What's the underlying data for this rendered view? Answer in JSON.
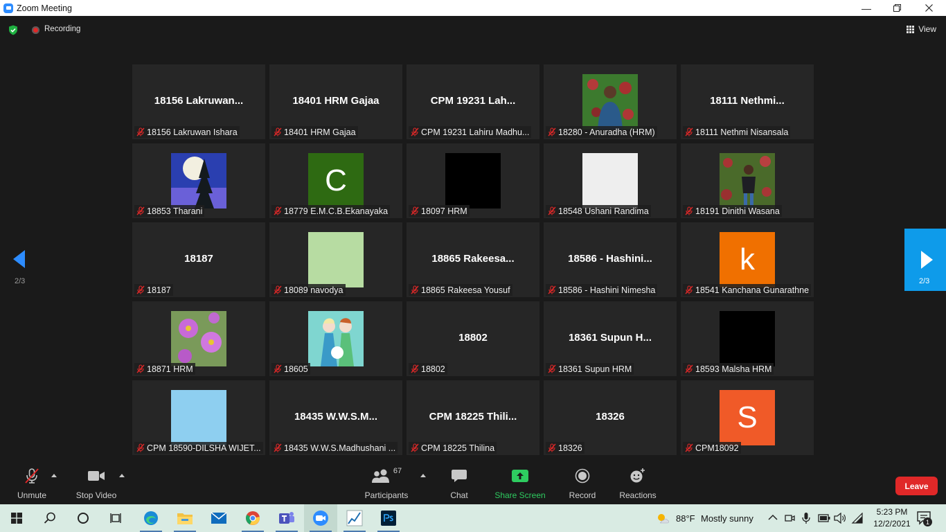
{
  "window": {
    "title": "Zoom Meeting"
  },
  "topbar": {
    "recording_label": "Recording",
    "view_label": "View"
  },
  "gallery": {
    "page_indicator": "2/3",
    "tiles": [
      {
        "big_name": "18156  Lakruwan...",
        "label": "18156 Lakruwan Ishara",
        "avatar": ""
      },
      {
        "big_name": "18401 HRM Gajaa",
        "label": "18401 HRM Gajaa",
        "avatar": ""
      },
      {
        "big_name": "CPM 19231  Lah...",
        "label": "CPM 19231  Lahiru Madhu...",
        "avatar": ""
      },
      {
        "big_name": "",
        "label": "18280 - Anuradha (HRM)",
        "avatar": "photo-man"
      },
      {
        "big_name": "18111  Nethmi...",
        "label": "18111 Nethmi Nisansala",
        "avatar": ""
      },
      {
        "big_name": "",
        "label": "18853 Tharani",
        "avatar": "moon-tree"
      },
      {
        "big_name": "",
        "label": "18779 E.M.C.B.Ekanayaka",
        "avatar": "letter-c",
        "letter": "C"
      },
      {
        "big_name": "",
        "label": "18097 HRM",
        "avatar": "black"
      },
      {
        "big_name": "",
        "label": "18548 Ushani Randima",
        "avatar": "white"
      },
      {
        "big_name": "",
        "label": "18191 Dinithi Wasana",
        "avatar": "photo-woman"
      },
      {
        "big_name": "18187",
        "label": "18187",
        "avatar": ""
      },
      {
        "big_name": "",
        "label": "18089 navodya",
        "avatar": "lightgreen"
      },
      {
        "big_name": "18865  Rakeesa...",
        "label": "18865 Rakeesa Yousuf",
        "avatar": ""
      },
      {
        "big_name": "18586 - Hashini...",
        "label": "18586 - Hashini Nimesha",
        "avatar": ""
      },
      {
        "big_name": "",
        "label": "18541 Kanchana Gunarathne",
        "avatar": "letter-k",
        "letter": "k"
      },
      {
        "big_name": "",
        "label": "18871 HRM",
        "avatar": "flowers"
      },
      {
        "big_name": "",
        "label": "18605",
        "avatar": "cartoon"
      },
      {
        "big_name": "18802",
        "label": "18802",
        "avatar": ""
      },
      {
        "big_name": "18361  Supun H...",
        "label": "18361 Supun HRM",
        "avatar": ""
      },
      {
        "big_name": "",
        "label": "18593 Malsha HRM",
        "avatar": "black"
      },
      {
        "big_name": "",
        "label": "CPM 18590-DILSHA WIJET...",
        "avatar": "skyblue"
      },
      {
        "big_name": "18435  W.W.S.M...",
        "label": "18435 W.W.S.Madhushani ...",
        "avatar": ""
      },
      {
        "big_name": "CPM 18225  Thili...",
        "label": "CPM 18225 Thilina",
        "avatar": ""
      },
      {
        "big_name": "18326",
        "label": "18326",
        "avatar": ""
      },
      {
        "big_name": "",
        "label": "CPM18092",
        "avatar": "letter-s",
        "letter": "S"
      }
    ]
  },
  "toolbar": {
    "unmute_label": "Unmute",
    "stop_video_label": "Stop Video",
    "participants_label": "Participants",
    "participants_count": "67",
    "chat_label": "Chat",
    "share_label": "Share Screen",
    "record_label": "Record",
    "reactions_label": "Reactions",
    "leave_label": "Leave"
  },
  "taskbar": {
    "weather_temp": "88°F",
    "weather_desc": "Mostly sunny",
    "time": "5:23 PM",
    "date": "12/2/2021",
    "notification_count": "1"
  },
  "colors": {
    "accent": "#2d8cff",
    "leave": "#e02828",
    "share_green": "#2ecc60",
    "avatar_c": "#2e6a12",
    "avatar_k": "#f07000",
    "avatar_s": "#f05a28"
  }
}
